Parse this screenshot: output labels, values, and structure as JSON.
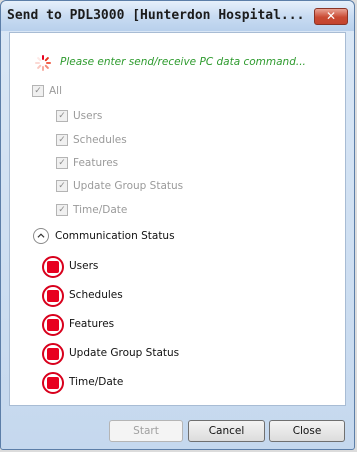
{
  "window": {
    "title": "Send to PDL3000 [Hunterdon Hospital...",
    "close_label": "✕"
  },
  "prompt": {
    "text": "Please enter send/receive PC data command..."
  },
  "options": {
    "all_label": "All",
    "items": [
      {
        "label": "Users"
      },
      {
        "label": "Schedules"
      },
      {
        "label": "Features"
      },
      {
        "label": "Update Group Status"
      },
      {
        "label": "Time/Date"
      }
    ]
  },
  "communication": {
    "label": "Communication Status",
    "items": [
      {
        "label": "Users",
        "status": "stopped"
      },
      {
        "label": "Schedules",
        "status": "stopped"
      },
      {
        "label": "Features",
        "status": "stopped"
      },
      {
        "label": "Update Group Status",
        "status": "stopped"
      },
      {
        "label": "Time/Date",
        "status": "stopped"
      }
    ]
  },
  "buttons": {
    "start": "Start",
    "cancel": "Cancel",
    "close": "Close"
  },
  "colors": {
    "prompt": "#2e9b2e",
    "status_red": "#e8001f"
  }
}
